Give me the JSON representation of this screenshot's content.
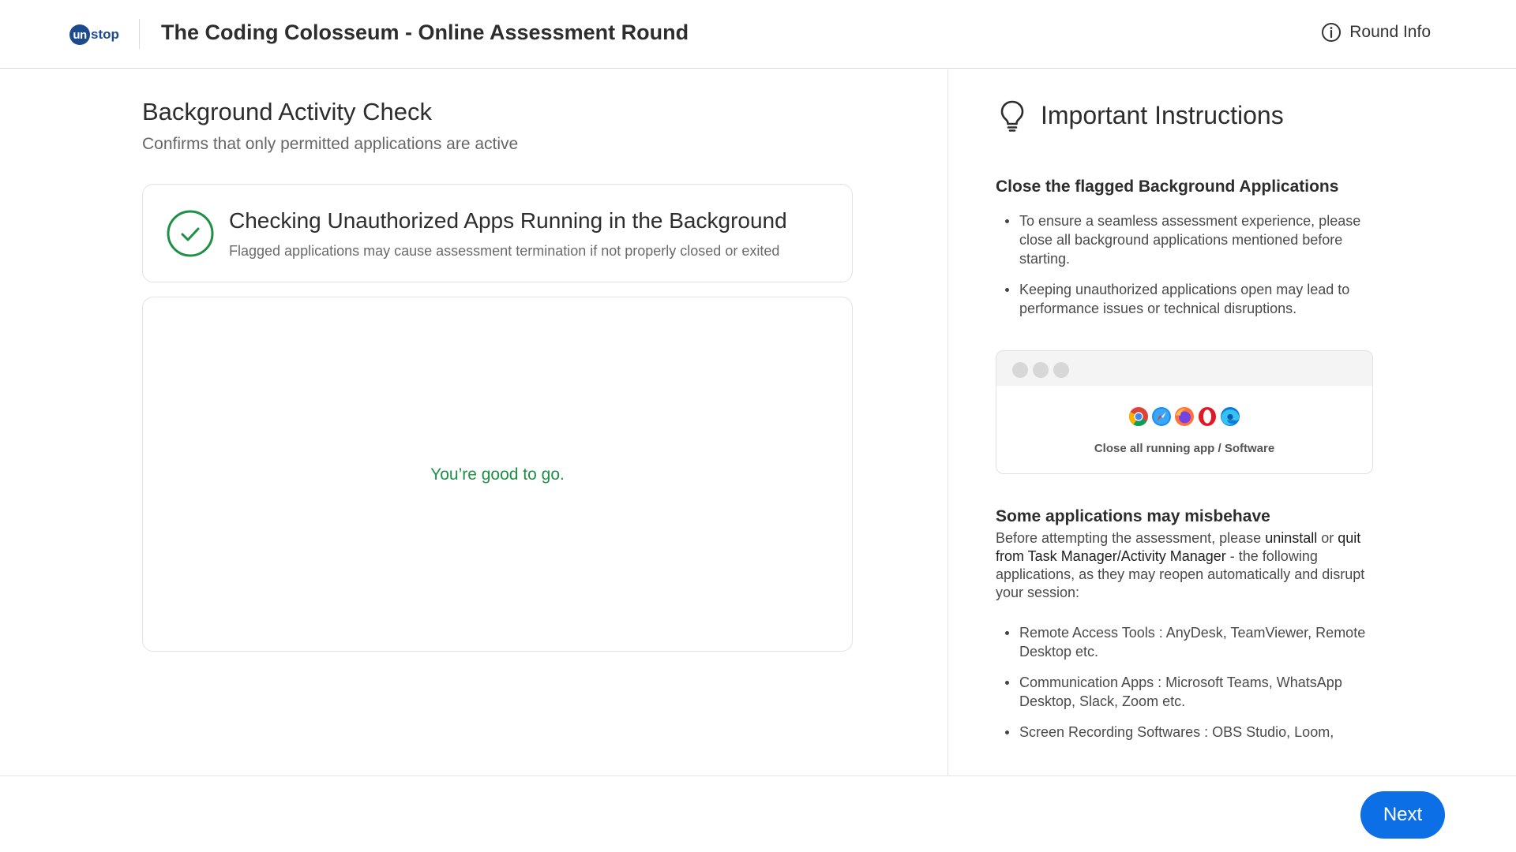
{
  "header": {
    "logo_mark": "un",
    "logo_text": "stop",
    "title": "The Coding Colosseum - Online Assessment Round",
    "round_info_label": "Round Info"
  },
  "main": {
    "section_title": "Background Activity Check",
    "section_subtitle": "Confirms that only permitted applications are active",
    "check_title": "Checking Unauthorized Apps Running in the Background",
    "check_subtitle": "Flagged applications may cause assessment termination if not properly closed or exited",
    "result_message": "You’re good to go."
  },
  "instructions": {
    "title": "Important Instructions",
    "close_heading": "Close the flagged Background Applications",
    "close_bullets": [
      "To ensure a seamless assessment experience, please close all background applications mentioned before starting.",
      "Keeping unauthorized applications open may lead to performance issues or technical disruptions."
    ],
    "window_icons": [
      "chrome-icon",
      "safari-icon",
      "firefox-icon",
      "opera-icon",
      "edge-icon"
    ],
    "window_caption": "Close all running app / Software",
    "misbehave_heading": "Some applications may misbehave",
    "misbehave_text": {
      "part1": "Before attempting the assessment, please ",
      "bold1": "uninstall",
      "part2": " or ",
      "bold2": "quit from Task Manager/Activity Manager",
      "part3": " - the following applications, as they may reopen automatically and disrupt your session:"
    },
    "app_bullets": [
      "Remote Access Tools : AnyDesk, TeamViewer, Remote Desktop etc.",
      "Communication Apps : Microsoft Teams, WhatsApp Desktop, Slack, Zoom etc.",
      "Screen Recording Softwares : OBS Studio, Loom,"
    ]
  },
  "footer": {
    "next_label": "Next"
  },
  "colors": {
    "brand": "#1c4a8f",
    "success": "#1e8f45",
    "primary_button": "#0c6fe5"
  }
}
